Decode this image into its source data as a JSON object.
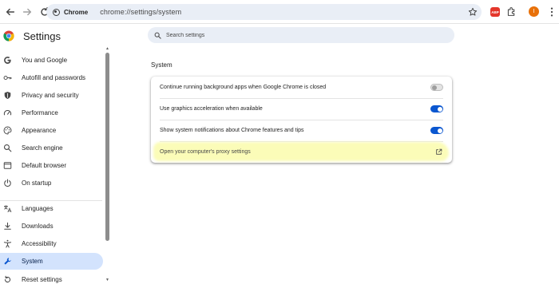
{
  "browser": {
    "tab_chip_label": "Chrome",
    "url": "chrome://settings/system",
    "extension_badge": "ABP",
    "profile_initial": "I"
  },
  "settings": {
    "title": "Settings",
    "search_placeholder": "Search settings"
  },
  "sidebar": {
    "items": [
      {
        "label": "You and Google",
        "icon": "google-g-icon"
      },
      {
        "label": "Autofill and passwords",
        "icon": "key-icon"
      },
      {
        "label": "Privacy and security",
        "icon": "shield-icon"
      },
      {
        "label": "Performance",
        "icon": "speedometer-icon"
      },
      {
        "label": "Appearance",
        "icon": "palette-icon"
      },
      {
        "label": "Search engine",
        "icon": "search-icon"
      },
      {
        "label": "Default browser",
        "icon": "browser-window-icon"
      },
      {
        "label": "On startup",
        "icon": "power-icon"
      },
      {
        "label": "Languages",
        "icon": "translate-icon"
      },
      {
        "label": "Downloads",
        "icon": "download-icon"
      },
      {
        "label": "Accessibility",
        "icon": "accessibility-icon"
      },
      {
        "label": "System",
        "icon": "wrench-icon"
      },
      {
        "label": "Reset settings",
        "icon": "reset-icon"
      }
    ],
    "active_item": "System"
  },
  "system": {
    "section_title": "System",
    "rows": [
      {
        "label": "Continue running background apps when Google Chrome is closed",
        "toggle": "off"
      },
      {
        "label": "Use graphics acceleration when available",
        "toggle": "on"
      },
      {
        "label": "Show system notifications about Chrome features and tips",
        "toggle": "on"
      }
    ],
    "proxy_link": "Open your computer's proxy settings"
  },
  "colors": {
    "accent": "#0b57d0",
    "active_nav_bg": "#d3e3fd",
    "highlight": "#fbfcb8"
  }
}
